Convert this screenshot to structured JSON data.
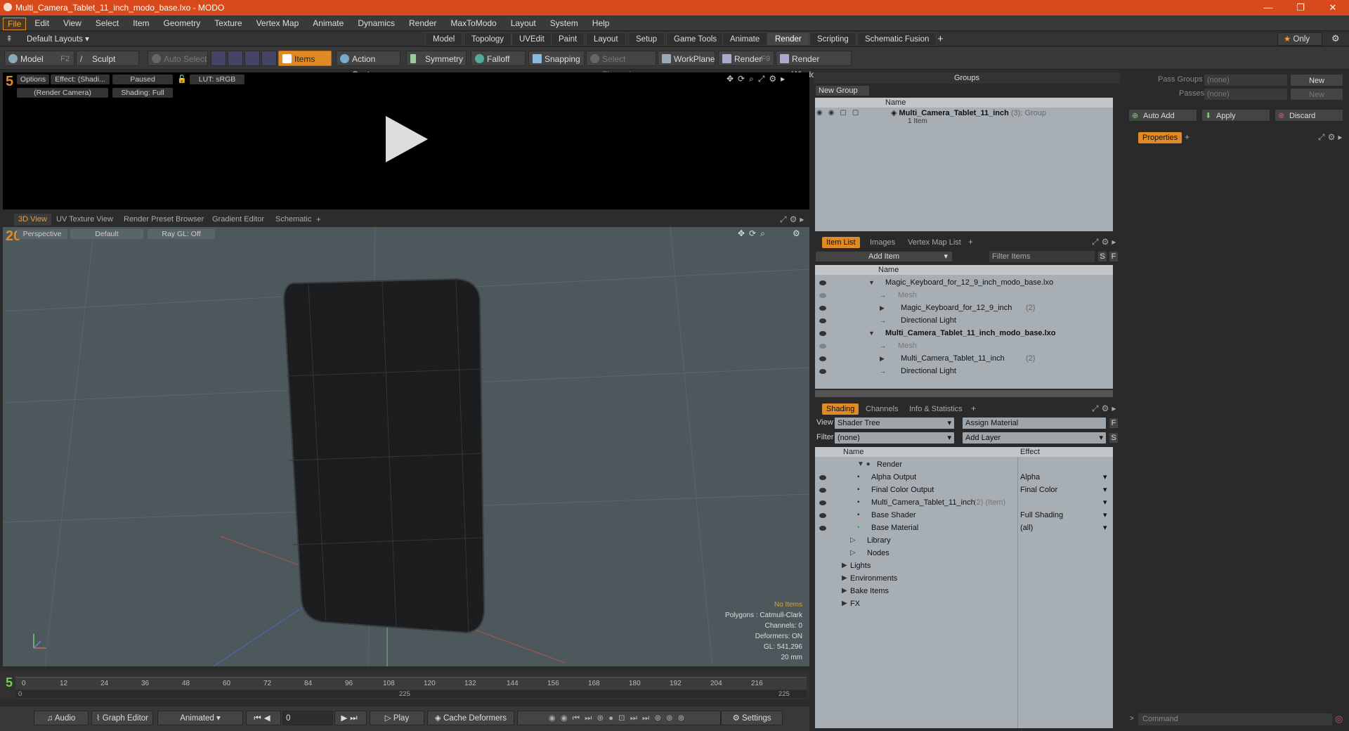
{
  "title": "Multi_Camera_Tablet_11_inch_modo_base.lxo - MODO",
  "menu": [
    "File",
    "Edit",
    "View",
    "Select",
    "Item",
    "Geometry",
    "Texture",
    "Vertex Map",
    "Animate",
    "Dynamics",
    "Render",
    "MaxToModo",
    "Layout",
    "System",
    "Help"
  ],
  "layout_tabs": {
    "preset": "Default Layouts ▾",
    "tabs": [
      "Model",
      "Topology",
      "UVEdit",
      "Paint",
      "Layout",
      "Setup",
      "Game Tools",
      "Animate",
      "Render",
      "Scripting",
      "Schematic Fusion"
    ],
    "only": "Only"
  },
  "toolbar": {
    "model": "Model",
    "model_key": "F2",
    "sculpt": "Sculpt",
    "auto_select": "Auto Select",
    "items": "Items",
    "action_center": "Action Center",
    "symmetry": "Symmetry",
    "falloff": "Falloff",
    "snapping": "Snapping",
    "select_through": "Select Through",
    "workplane": "WorkPlane",
    "render": "Render",
    "render_key": "F9",
    "render_window": "Render Window"
  },
  "render_view": {
    "options": "Options",
    "effect": "Effect: (Shadi...",
    "paused": "Paused",
    "lut": "LUT: sRGB",
    "camera": "(Render Camera)",
    "shading": "Shading: Full"
  },
  "vp_tabs": [
    "3D View",
    "UV Texture View",
    "Render Preset Browser",
    "Gradient Editor",
    "Schematic"
  ],
  "viewport": {
    "perspective": "Perspective",
    "default": "Default",
    "raygl": "Ray GL: Off",
    "no_items": "No Items",
    "polygons": "Polygons : Catmull-Clark",
    "channels": "Channels: 0",
    "deformers": "Deformers: ON",
    "gl": "GL: 541,296",
    "scale": "20 mm"
  },
  "groups": {
    "header": "Groups",
    "new_group": "New Group",
    "col_name": "Name",
    "item_name": "Multi_Camera_Tablet_11_inch",
    "item_count": "(3)",
    "item_type": ": Group",
    "item_sub": "1 Item"
  },
  "pass": {
    "pass_groups": "Pass Groups",
    "passes": "Passes",
    "none": "(none)",
    "new": "New",
    "auto_add": "Auto Add",
    "apply": "Apply",
    "discard": "Discard",
    "properties": "Properties"
  },
  "itemlist": {
    "tabs": [
      "Item List",
      "Images",
      "Vertex Map List"
    ],
    "add_item": "Add Item",
    "filter": "Filter Items",
    "col_name": "Name",
    "rows": [
      {
        "label": "Magic_Keyboard_for_12_9_inch_modo_base.lxo",
        "indent": 0,
        "bold": false,
        "dim": false,
        "extra": ""
      },
      {
        "label": "Mesh",
        "indent": 2,
        "bold": false,
        "dim": true,
        "extra": ""
      },
      {
        "label": "Magic_Keyboard_for_12_9_inch",
        "indent": 1,
        "bold": false,
        "dim": false,
        "extra": "(2)"
      },
      {
        "label": "Directional Light",
        "indent": 1,
        "bold": false,
        "dim": false,
        "extra": ""
      },
      {
        "label": "Multi_Camera_Tablet_11_inch_modo_base.lxo",
        "indent": 0,
        "bold": true,
        "dim": false,
        "extra": ""
      },
      {
        "label": "Mesh",
        "indent": 2,
        "bold": false,
        "dim": true,
        "extra": ""
      },
      {
        "label": "Multi_Camera_Tablet_11_inch",
        "indent": 1,
        "bold": false,
        "dim": false,
        "extra": "(2)"
      },
      {
        "label": "Directional Light",
        "indent": 1,
        "bold": false,
        "dim": false,
        "extra": ""
      }
    ]
  },
  "shading": {
    "tabs": [
      "Shading",
      "Channels",
      "Info & Statistics"
    ],
    "view_label": "View",
    "view_value": "Shader Tree",
    "assign": "Assign Material",
    "filter_label": "Filter",
    "filter_value": "(none)",
    "add_layer": "Add Layer",
    "col_name": "Name",
    "col_effect": "Effect",
    "rows": [
      {
        "label": "Render",
        "effect": "",
        "indent": 0
      },
      {
        "label": "Alpha Output",
        "effect": "Alpha",
        "indent": 1
      },
      {
        "label": "Final Color Output",
        "effect": "Final Color",
        "indent": 1
      },
      {
        "label": "Multi_Camera_Tablet_11_inch",
        "extra": "(2) (Item)",
        "effect": "",
        "indent": 1
      },
      {
        "label": "Base Shader",
        "effect": "Full Shading",
        "indent": 1
      },
      {
        "label": "Base Material",
        "effect": "(all)",
        "indent": 1
      },
      {
        "label": "Library",
        "effect": "",
        "indent": 0
      },
      {
        "label": "Nodes",
        "effect": "",
        "indent": 0
      },
      {
        "label": "Lights",
        "effect": "",
        "indent": -1
      },
      {
        "label": "Environments",
        "effect": "",
        "indent": -1
      },
      {
        "label": "Bake Items",
        "effect": "",
        "indent": -1
      },
      {
        "label": "FX",
        "effect": "",
        "indent": -1
      }
    ]
  },
  "timeline": {
    "ticks": [
      "0",
      "12",
      "24",
      "36",
      "48",
      "60",
      "72",
      "84",
      "96",
      "108",
      "120",
      "132",
      "144",
      "156",
      "168",
      "180",
      "192",
      "204",
      "216"
    ],
    "left_end": "0",
    "mid": "225",
    "right_end": "225"
  },
  "bottom": {
    "audio": "Audio",
    "graph": "Graph Editor",
    "animated": "Animated",
    "frame": "0",
    "play": "Play",
    "cache": "Cache Deformers",
    "settings": "Settings",
    "command": "Command"
  },
  "colors": {
    "titlebar": "#d84a1b",
    "accent": "#e08a25"
  }
}
